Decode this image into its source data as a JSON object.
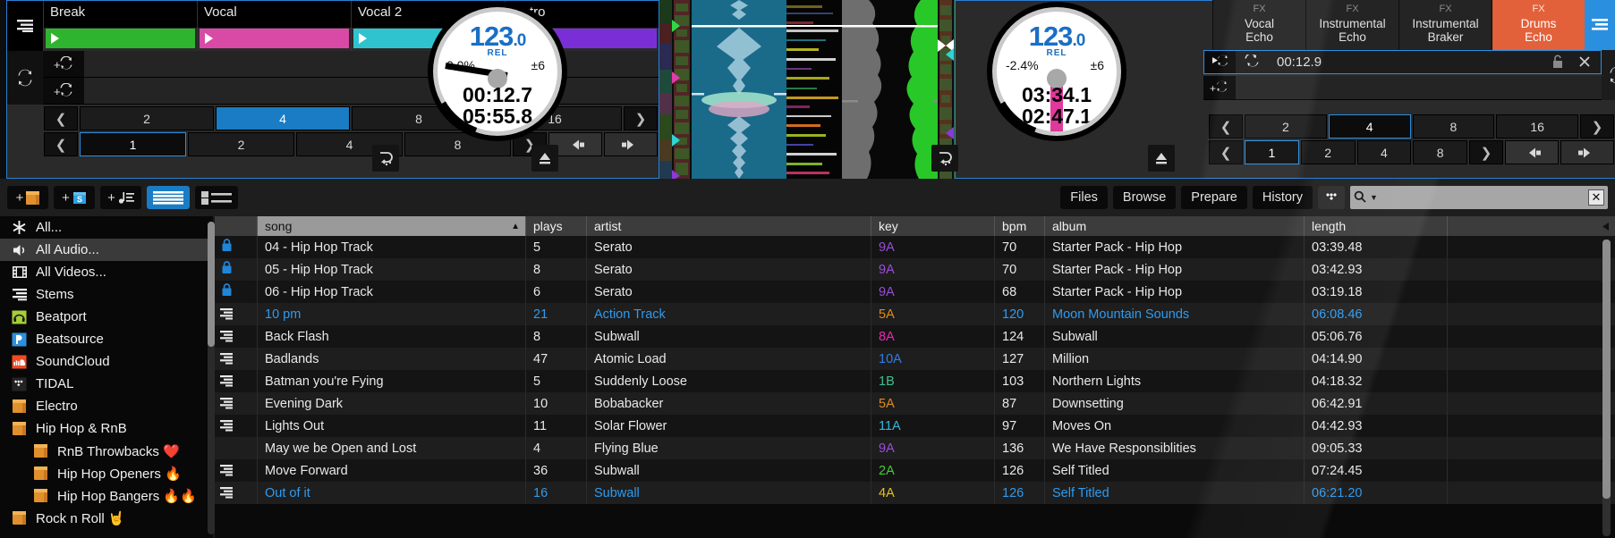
{
  "decks": {
    "deck1": {
      "cues": [
        {
          "label": "Break",
          "color": "#2fb42f"
        },
        {
          "label": "Vocal",
          "color": "#d84aa6"
        },
        {
          "label": "Vocal 2",
          "color": "#2fc3cf"
        },
        {
          "label": "Outro",
          "color": "#7a2fd6"
        }
      ],
      "platter": {
        "bpm": "123",
        "bpm_dec": ".0",
        "rel": "REL",
        "pitch": "0.0%",
        "range": "±6",
        "elapsed": "00:12.7",
        "remaining": "05:55.8"
      },
      "beat_sizes": [
        "2",
        "4",
        "8",
        "16"
      ],
      "beat_selected": "4",
      "jump_sizes": [
        "1",
        "2",
        "4",
        "8"
      ],
      "jump_selected": "1"
    },
    "deck2": {
      "platter": {
        "bpm": "123",
        "bpm_dec": ".0",
        "rel": "REL",
        "pitch": "-2.4%",
        "range": "±6",
        "elapsed": "03:34.1",
        "remaining": "02:47.1"
      },
      "loop_time": "00:12.9",
      "beat_sizes": [
        "2",
        "4",
        "8",
        "16"
      ],
      "beat_selected": "4",
      "jump_sizes": [
        "1",
        "2",
        "4",
        "8"
      ],
      "jump_selected": "1"
    }
  },
  "fx": {
    "slots": [
      {
        "kind": "FX",
        "name_line1": "Vocal",
        "name_line2": "Echo",
        "active": false
      },
      {
        "kind": "FX",
        "name_line1": "Instrumental",
        "name_line2": "Echo",
        "active": false
      },
      {
        "kind": "FX",
        "name_line1": "Instrumental",
        "name_line2": "Braker",
        "active": false
      },
      {
        "kind": "FX",
        "name_line1": "Drums",
        "name_line2": "Echo",
        "active": true
      }
    ],
    "active_color": "#e3613a"
  },
  "toolbar": {
    "add_crate_label": "+",
    "add_smart_crate_label": "+",
    "add_playlist_label": "+",
    "tabs": [
      "Files",
      "Browse",
      "Prepare",
      "History"
    ],
    "search_placeholder": "",
    "search_value": "",
    "search_icon": "search-icon",
    "clear_label": "✕"
  },
  "sidebar": {
    "items": [
      {
        "label": "All...",
        "icon": "asterisk-icon",
        "indent": false,
        "selected": false
      },
      {
        "label": "All Audio...",
        "icon": "speaker-icon",
        "indent": false,
        "selected": true
      },
      {
        "label": "All Videos...",
        "icon": "film-icon",
        "indent": false,
        "selected": false
      },
      {
        "label": "Stems",
        "icon": "stems-icon",
        "indent": false,
        "selected": false
      },
      {
        "label": "Beatport",
        "icon": "beatport-icon",
        "indent": false,
        "selected": false
      },
      {
        "label": "Beatsource",
        "icon": "beatsource-icon",
        "indent": false,
        "selected": false
      },
      {
        "label": "SoundCloud",
        "icon": "soundcloud-icon",
        "indent": false,
        "selected": false
      },
      {
        "label": "TIDAL",
        "icon": "tidal-icon",
        "indent": false,
        "selected": false
      },
      {
        "label": "Electro",
        "icon": "crate-icon",
        "indent": false,
        "selected": false
      },
      {
        "label": "Hip Hop & RnB",
        "icon": "crate-open-icon",
        "indent": false,
        "selected": false
      },
      {
        "label": "RnB Throwbacks ❤️",
        "icon": "crate-icon",
        "indent": true,
        "selected": false
      },
      {
        "label": "Hip Hop Openers 🔥",
        "icon": "crate-icon",
        "indent": true,
        "selected": false
      },
      {
        "label": "Hip Hop Bangers 🔥🔥",
        "icon": "crate-icon",
        "indent": true,
        "selected": false
      },
      {
        "label": "Rock n Roll 🤘",
        "icon": "crate-icon",
        "indent": false,
        "selected": false
      }
    ]
  },
  "table": {
    "columns": [
      {
        "key": "song",
        "label": "song",
        "sorted": true,
        "sort_dir": "▲"
      },
      {
        "key": "plays",
        "label": "plays"
      },
      {
        "key": "artist",
        "label": "artist"
      },
      {
        "key": "key",
        "label": "key"
      },
      {
        "key": "bpm",
        "label": "bpm"
      },
      {
        "key": "album",
        "label": "album"
      },
      {
        "key": "length",
        "label": "length"
      }
    ],
    "rows": [
      {
        "icon": "lock-icon",
        "song": "04 - Hip Hop Track",
        "plays": "5",
        "artist": "Serato",
        "key": "9A",
        "key_color": "#9b4dd8",
        "bpm": "70",
        "album": "Starter Pack - Hip Hop",
        "length": "03:39.48",
        "played": false
      },
      {
        "icon": "lock-icon",
        "song": "05 - Hip Hop Track",
        "plays": "8",
        "artist": "Serato",
        "key": "9A",
        "key_color": "#9b4dd8",
        "bpm": "70",
        "album": "Starter Pack - Hip Hop",
        "length": "03:42.93",
        "played": false
      },
      {
        "icon": "lock-icon",
        "song": "06 - Hip Hop Track",
        "plays": "6",
        "artist": "Serato",
        "key": "9A",
        "key_color": "#9b4dd8",
        "bpm": "68",
        "album": "Starter Pack - Hip Hop",
        "length": "03:19.18",
        "played": false
      },
      {
        "icon": "stems-icon",
        "song": "10 pm",
        "plays": "21",
        "artist": "Action Track",
        "key": "5A",
        "key_color": "#e08c1a",
        "bpm": "120",
        "album": "Moon Mountain Sounds",
        "length": "06:08.46",
        "played": true
      },
      {
        "icon": "stems-icon",
        "song": "Back Flash",
        "plays": "8",
        "artist": "Subwall",
        "key": "8A",
        "key_color": "#e32bb0",
        "bpm": "124",
        "album": "Subwall",
        "length": "05:06.76",
        "played": false
      },
      {
        "icon": "stems-icon",
        "song": "Badlands",
        "plays": "47",
        "artist": "Atomic Load",
        "key": "10A",
        "key_color": "#2f7fe8",
        "bpm": "127",
        "album": "Million",
        "length": "04:14.90",
        "played": false
      },
      {
        "icon": "stems-icon",
        "song": "Batman you're Fying",
        "plays": "5",
        "artist": "Suddenly Loose",
        "key": "1B",
        "key_color": "#3fbf8f",
        "bpm": "103",
        "album": "Northern Lights",
        "length": "04:18.32",
        "played": false
      },
      {
        "icon": "stems-icon",
        "song": "Evening Dark",
        "plays": "10",
        "artist": "Bobabacker",
        "key": "5A",
        "key_color": "#e08c1a",
        "bpm": "87",
        "album": "Downsetting",
        "length": "06:42.91",
        "played": false
      },
      {
        "icon": "stems-icon",
        "song": "Lights Out",
        "plays": "11",
        "artist": "Solar Flower",
        "key": "11A",
        "key_color": "#2fb8e0",
        "bpm": "97",
        "album": "Moves On",
        "length": "04:42.93",
        "played": false
      },
      {
        "icon": "none",
        "song": "May we be Open and Lost",
        "plays": "4",
        "artist": "Flying Blue",
        "key": "9A",
        "key_color": "#9b4dd8",
        "bpm": "136",
        "album": "We Have Responsiblities",
        "length": "09:05.33",
        "played": false
      },
      {
        "icon": "stems-icon",
        "song": "Move Forward",
        "plays": "36",
        "artist": "Subwall",
        "key": "2A",
        "key_color": "#49c93a",
        "bpm": "126",
        "album": "Self Titled",
        "length": "07:24.45",
        "played": false
      },
      {
        "icon": "stems-icon",
        "song": "Out of it",
        "plays": "16",
        "artist": "Subwall",
        "key": "4A",
        "key_color": "#e8c21a",
        "bpm": "126",
        "album": "Self Titled",
        "length": "06:21.20",
        "played": true
      }
    ]
  },
  "colors": {
    "accent_blue": "#2b8fe0",
    "played_blue": "#2e9bf0",
    "selected_tab": "#1a7cc4",
    "fx_active": "#e3613a"
  }
}
